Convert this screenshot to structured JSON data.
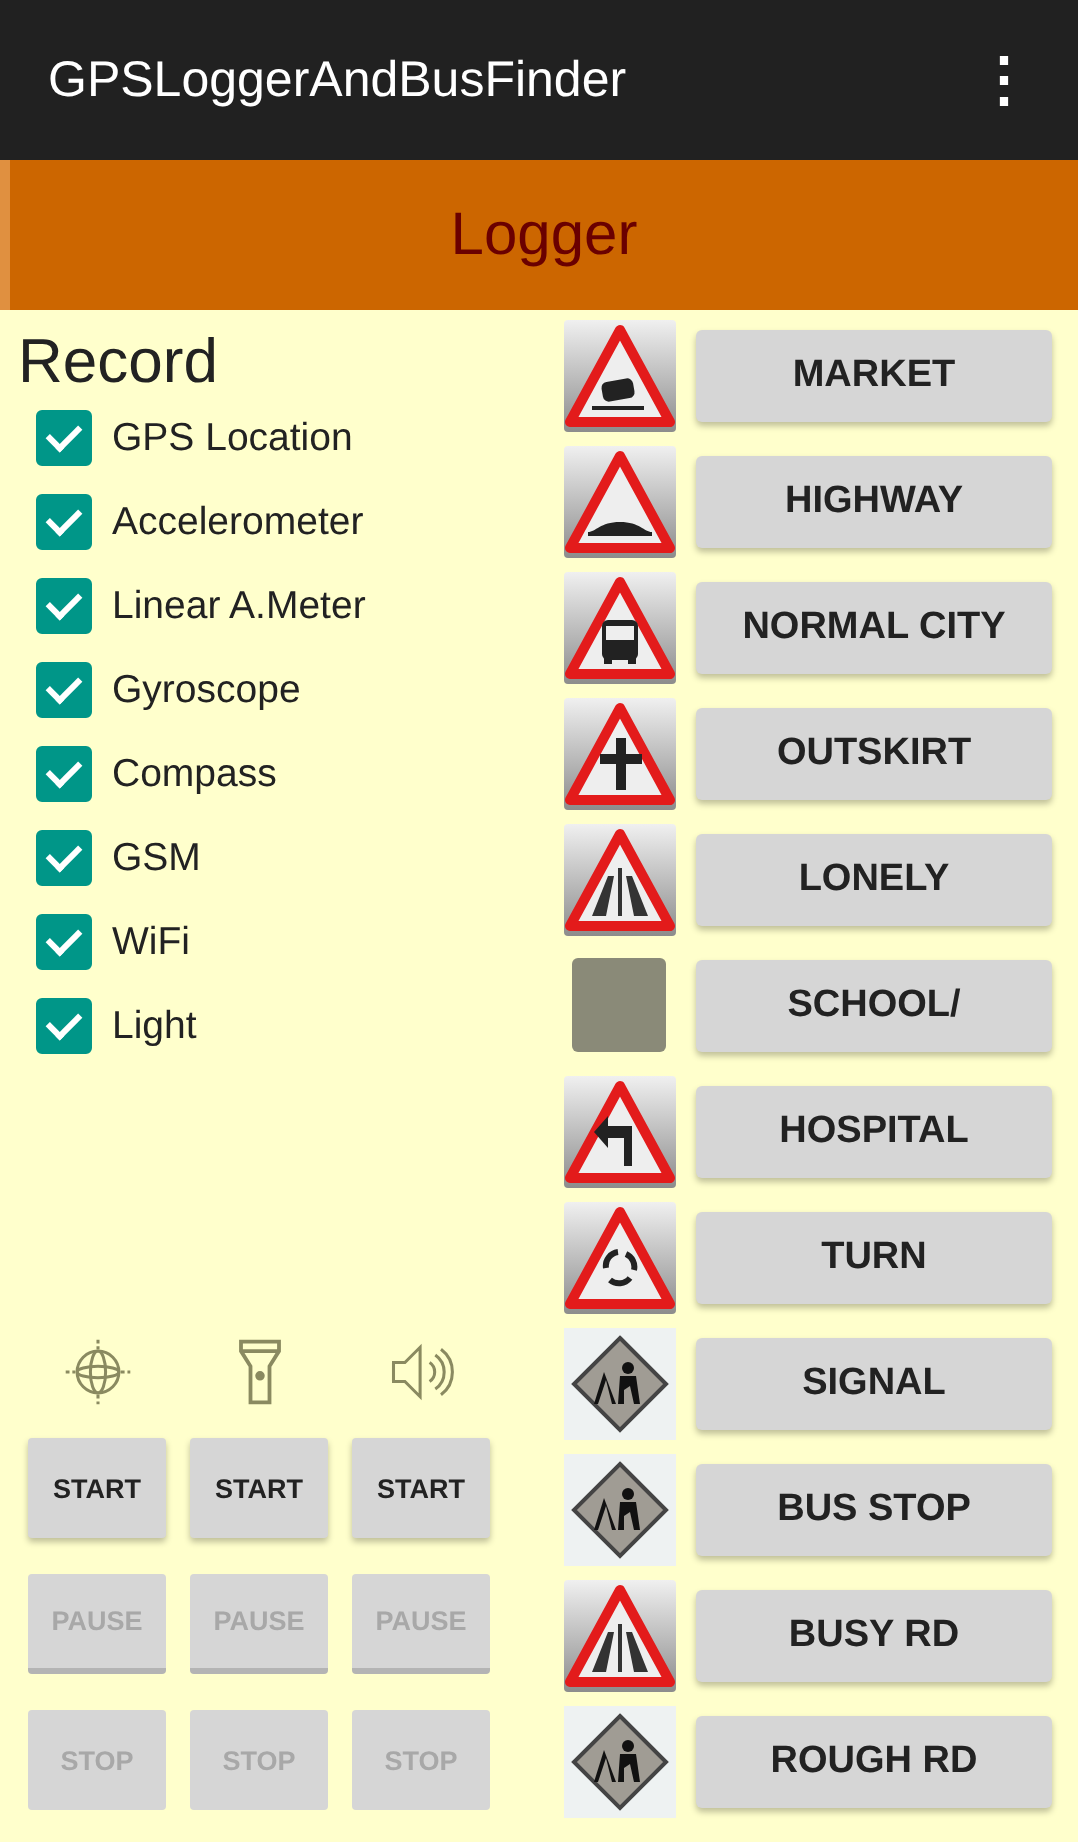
{
  "app_bar": {
    "title": "GPSLoggerAndBusFinder",
    "menu": "⋮"
  },
  "header": {
    "title": "Logger"
  },
  "record": {
    "title": "Record",
    "sensors": [
      {
        "label": "GPS Location",
        "checked": true
      },
      {
        "label": "Accelerometer",
        "checked": true
      },
      {
        "label": "Linear A.Meter",
        "checked": true
      },
      {
        "label": "Gyroscope",
        "checked": true
      },
      {
        "label": "Compass",
        "checked": true
      },
      {
        "label": "GSM",
        "checked": true
      },
      {
        "label": "WiFi",
        "checked": true
      },
      {
        "label": "Light",
        "checked": true
      }
    ]
  },
  "controls": [
    {
      "kind": "gps",
      "buttons": [
        {
          "kind": "start",
          "label": "START",
          "disabled": false
        },
        {
          "kind": "pause",
          "label": "PAUSE",
          "disabled": true
        },
        {
          "kind": "stop",
          "label": "STOP",
          "disabled": true
        }
      ]
    },
    {
      "kind": "light",
      "buttons": [
        {
          "kind": "start",
          "label": "START",
          "disabled": false
        },
        {
          "kind": "pause",
          "label": "PAUSE",
          "disabled": true
        },
        {
          "kind": "stop",
          "label": "STOP",
          "disabled": true
        }
      ]
    },
    {
      "kind": "sound",
      "buttons": [
        {
          "kind": "start",
          "label": "START",
          "disabled": false
        },
        {
          "kind": "pause",
          "label": "PAUSE",
          "disabled": true
        },
        {
          "kind": "stop",
          "label": "STOP",
          "disabled": true
        }
      ]
    }
  ],
  "places": [
    {
      "kind": "car",
      "label": "MARKET"
    },
    {
      "kind": "bump",
      "label": "HIGHWAY"
    },
    {
      "kind": "bus",
      "label": "NORMAL CITY"
    },
    {
      "kind": "cross",
      "label": "OUTSKIRT"
    },
    {
      "kind": "traffic",
      "label": "LONELY"
    },
    {
      "kind": "blank",
      "label": "SCHOOL/"
    },
    {
      "kind": "turn",
      "label": "HOSPITAL"
    },
    {
      "kind": "roundabout",
      "label": "TURN"
    },
    {
      "kind": "worker",
      "label": "SIGNAL"
    },
    {
      "kind": "worker",
      "label": "BUS STOP"
    },
    {
      "kind": "traffic",
      "label": "BUSY RD"
    },
    {
      "kind": "worker",
      "label": "ROUGH RD"
    }
  ]
}
